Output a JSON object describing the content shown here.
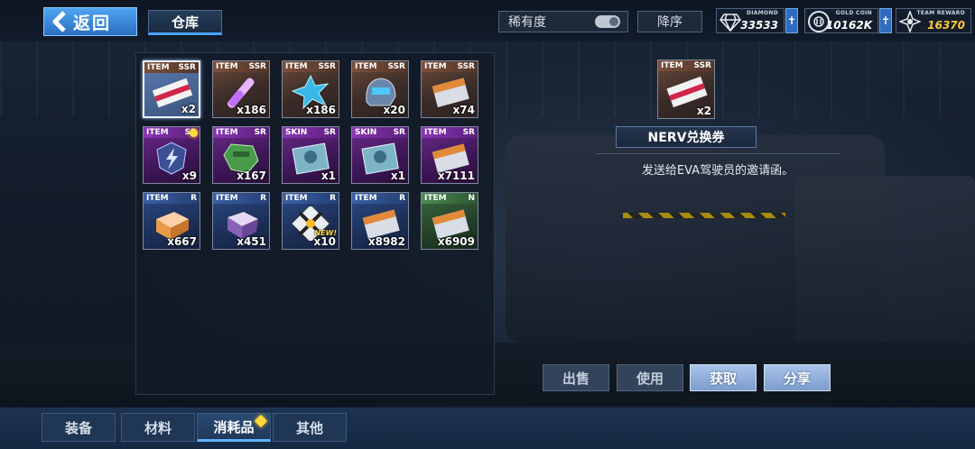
{
  "header": {
    "back_label": "返回",
    "title": "仓库",
    "rarity_filter": "稀有度",
    "order_label": "降序"
  },
  "currencies": [
    {
      "caption": "DIAMOND",
      "value": "33533",
      "icon": "diamond-icon",
      "color": "#ffffff"
    },
    {
      "caption": "GOLD COIN",
      "value": "10162K",
      "icon": "gold-coin-icon",
      "color": "#ffffff"
    },
    {
      "caption": "TEAM REWARD",
      "value": "16370",
      "icon": "team-reward-icon",
      "color": "#ffc63a"
    }
  ],
  "inventory": [
    {
      "type": "ITEM",
      "rarity": "SSR",
      "qty": "x2",
      "icon": "confidential-ticket-icon",
      "selected": true
    },
    {
      "type": "ITEM",
      "rarity": "SSR",
      "qty": "x186",
      "icon": "test-tube-icon"
    },
    {
      "type": "ITEM",
      "rarity": "SSR",
      "qty": "x186",
      "icon": "crystal-core-icon"
    },
    {
      "type": "ITEM",
      "rarity": "SSR",
      "qty": "x20",
      "icon": "helmet-icon"
    },
    {
      "type": "ITEM",
      "rarity": "SSR",
      "qty": "x74",
      "icon": "ticket-icon"
    },
    {
      "type": "ITEM",
      "rarity": "SR",
      "qty": "x9",
      "icon": "lightning-badge-icon",
      "badge": true
    },
    {
      "type": "ITEM",
      "rarity": "SR",
      "qty": "x167",
      "icon": "green-gem-icon"
    },
    {
      "type": "SKIN",
      "rarity": "SR",
      "qty": "x1",
      "icon": "skin-card-icon"
    },
    {
      "type": "SKIN",
      "rarity": "SR",
      "qty": "x1",
      "icon": "skin-card-icon"
    },
    {
      "type": "ITEM",
      "rarity": "SR",
      "qty": "x7111",
      "icon": "ticket-icon"
    },
    {
      "type": "ITEM",
      "rarity": "R",
      "qty": "x667",
      "icon": "gift-box-icon"
    },
    {
      "type": "ITEM",
      "rarity": "R",
      "qty": "x451",
      "icon": "purple-cube-icon"
    },
    {
      "type": "ITEM",
      "rarity": "R",
      "qty": "x10",
      "icon": "supply-crate-icon",
      "new": "NEW!"
    },
    {
      "type": "ITEM",
      "rarity": "R",
      "qty": "x8982",
      "icon": "ticket-icon"
    },
    {
      "type": "ITEM",
      "rarity": "N",
      "qty": "x6909",
      "icon": "ticket-icon"
    }
  ],
  "detail": {
    "type": "ITEM",
    "rarity": "SSR",
    "qty": "x2",
    "name": "NERV兑换券",
    "description": "发送给EVA驾驶员的邀请函。"
  },
  "actions": {
    "sell": "出售",
    "use": "使用",
    "obtain": "获取",
    "share": "分享"
  },
  "bottom_tabs": [
    {
      "label": "装备",
      "active": false
    },
    {
      "label": "材料",
      "active": false
    },
    {
      "label": "消耗品",
      "active": true,
      "badge": true
    },
    {
      "label": "其他",
      "active": false
    }
  ],
  "colors": {
    "accent": "#4aa3ff",
    "ssr": "#7b4f3a",
    "sr": "#8a36b3",
    "r": "#3a5fa6",
    "n": "#4c8a52",
    "badge": "#ffd83b"
  }
}
